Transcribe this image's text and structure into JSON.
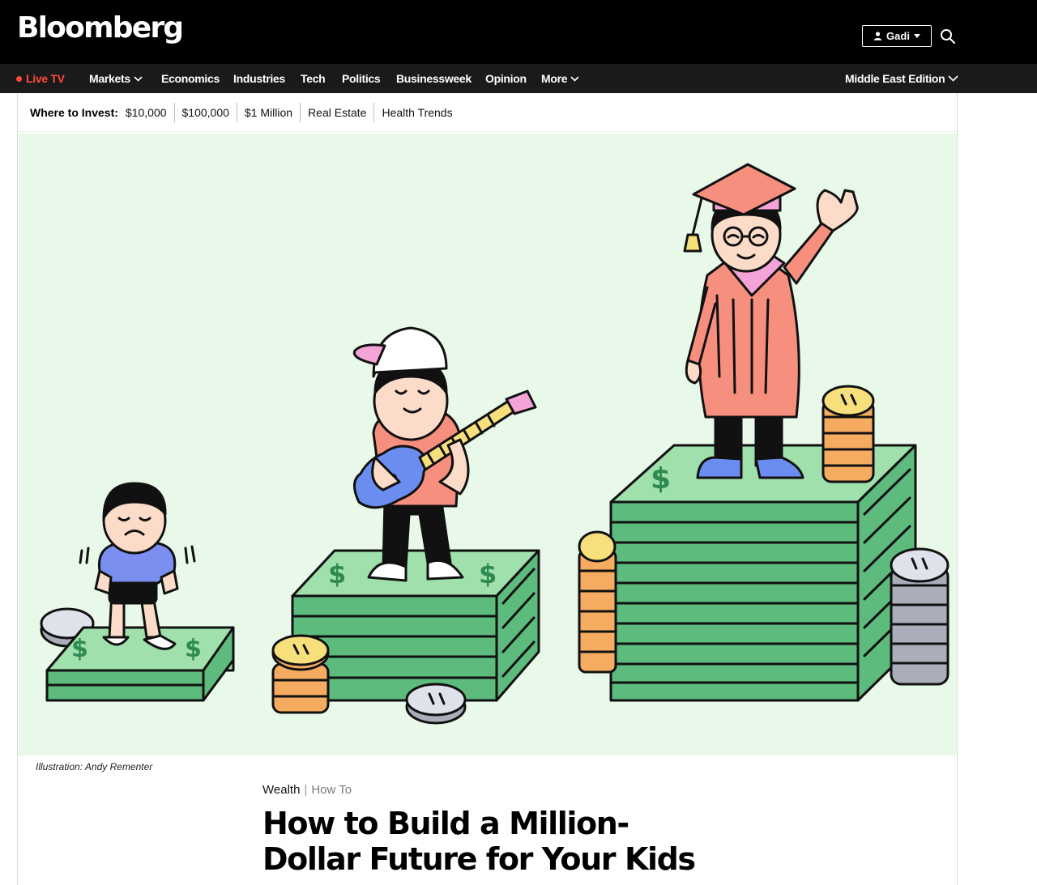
{
  "header": {
    "logo": "Bloomberg",
    "user_label": "Gadi",
    "user_icon": "person-icon",
    "search_icon": "search-icon"
  },
  "nav": {
    "live": "Live TV",
    "markets": "Markets",
    "economics": "Economics",
    "industries": "Industries",
    "tech": "Tech",
    "politics": "Politics",
    "businessweek": "Businessweek",
    "opinion": "Opinion",
    "more": "More",
    "edition": "Middle East Edition"
  },
  "subnav": {
    "title": "Where to Invest:",
    "links": [
      "$10,000",
      "$100,000",
      "$1 Million",
      "Real Estate",
      "Health Trends"
    ]
  },
  "article": {
    "image_credit": "Illustration: Andy Rementer",
    "category": "Wealth",
    "separator": "|",
    "subcategory": "How To",
    "headline_line1": "How to Build a Million-",
    "headline_line2": "Dollar Future for Your Kids"
  },
  "colors": {
    "live_red": "#ff4a3d",
    "hero_background": "#e9f9e9",
    "cash_green": "#5dbb7e",
    "cash_top": "#9fe0ad",
    "coin_gold": "#f6ac60",
    "coin_silver": "#a9aeba"
  }
}
